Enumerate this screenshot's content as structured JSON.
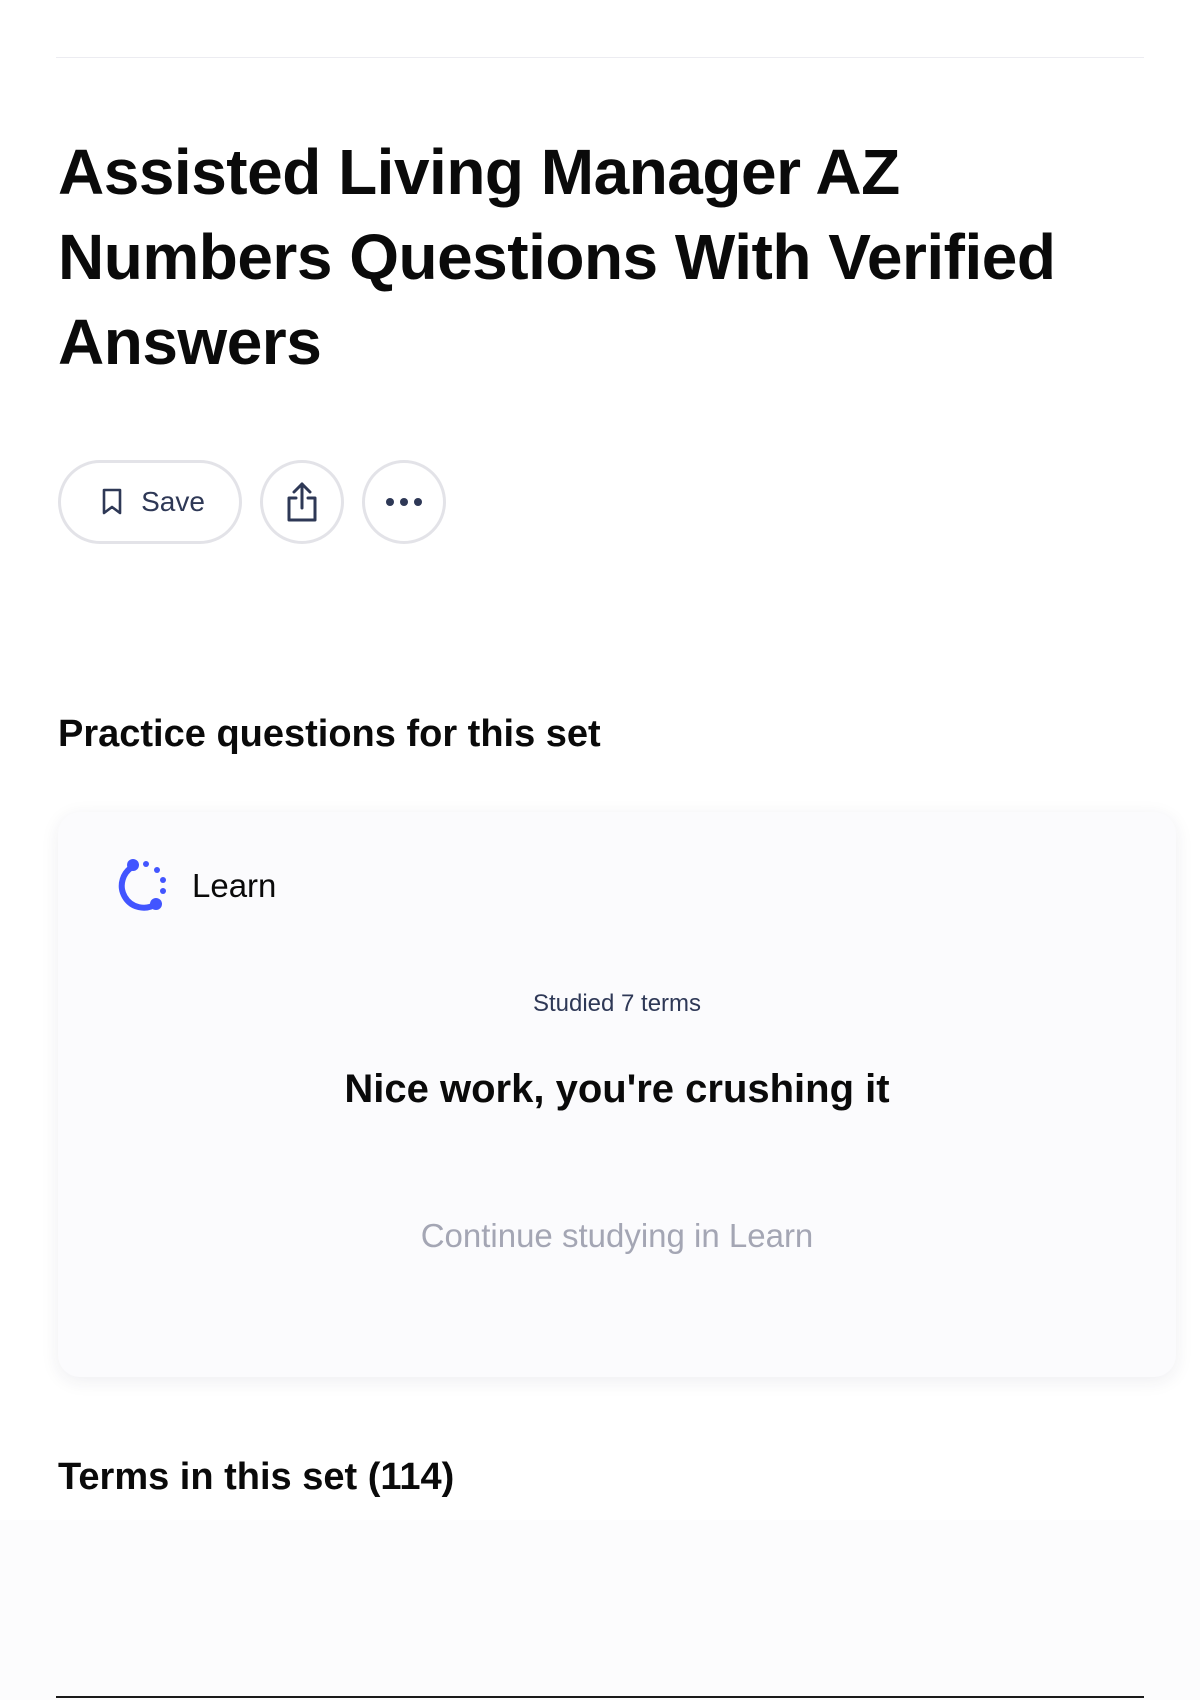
{
  "set": {
    "title": "Assisted Living Manager AZ Numbers Questions With Verified Answers"
  },
  "actions": {
    "save_label": "Save",
    "save_icon": "bookmark-icon",
    "share_icon": "share-icon",
    "more_icon": "more-horizontal-icon"
  },
  "practice": {
    "heading": "Practice questions for this set",
    "learn": {
      "icon": "learn-progress-icon",
      "label": "Learn",
      "studied_text": "Studied 7 terms",
      "message": "Nice work, you're crushing it",
      "continue_label": "Continue studying in Learn"
    }
  },
  "terms": {
    "heading": "Terms in this set (114)"
  },
  "colors": {
    "accent": "#4255ff",
    "muted_text": "#a4a6b4",
    "secondary_text": "#2e3856",
    "border": "#e3e3e8"
  }
}
